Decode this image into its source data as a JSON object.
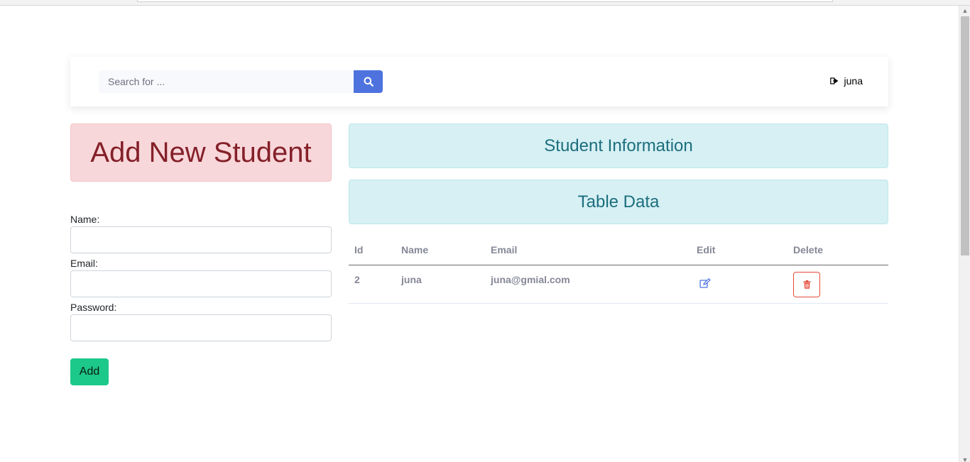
{
  "search": {
    "placeholder": "Search for ..."
  },
  "user": {
    "name": "juna",
    "icon": "sign-out-icon"
  },
  "add_section": {
    "title": "Add New Student",
    "fields": [
      {
        "label": "Name:",
        "value": ""
      },
      {
        "label": "Email:",
        "value": ""
      },
      {
        "label": "Password:",
        "value": ""
      }
    ],
    "submit_label": "Add"
  },
  "info_section": {
    "title": "Student Information",
    "subtitle": "Table Data"
  },
  "table": {
    "headers": [
      "Id",
      "Name",
      "Email",
      "Edit",
      "Delete"
    ],
    "rows": [
      {
        "id": "2",
        "name": "juna",
        "email": "juna@gmial.com",
        "edit_icon": "edit-icon",
        "delete_icon": "trash-icon"
      }
    ]
  },
  "colors": {
    "primary": "#4e73df",
    "success": "#1cc88a",
    "danger": "#e74a3b",
    "info_text": "#1c6e7d",
    "danger_text": "#842029"
  }
}
